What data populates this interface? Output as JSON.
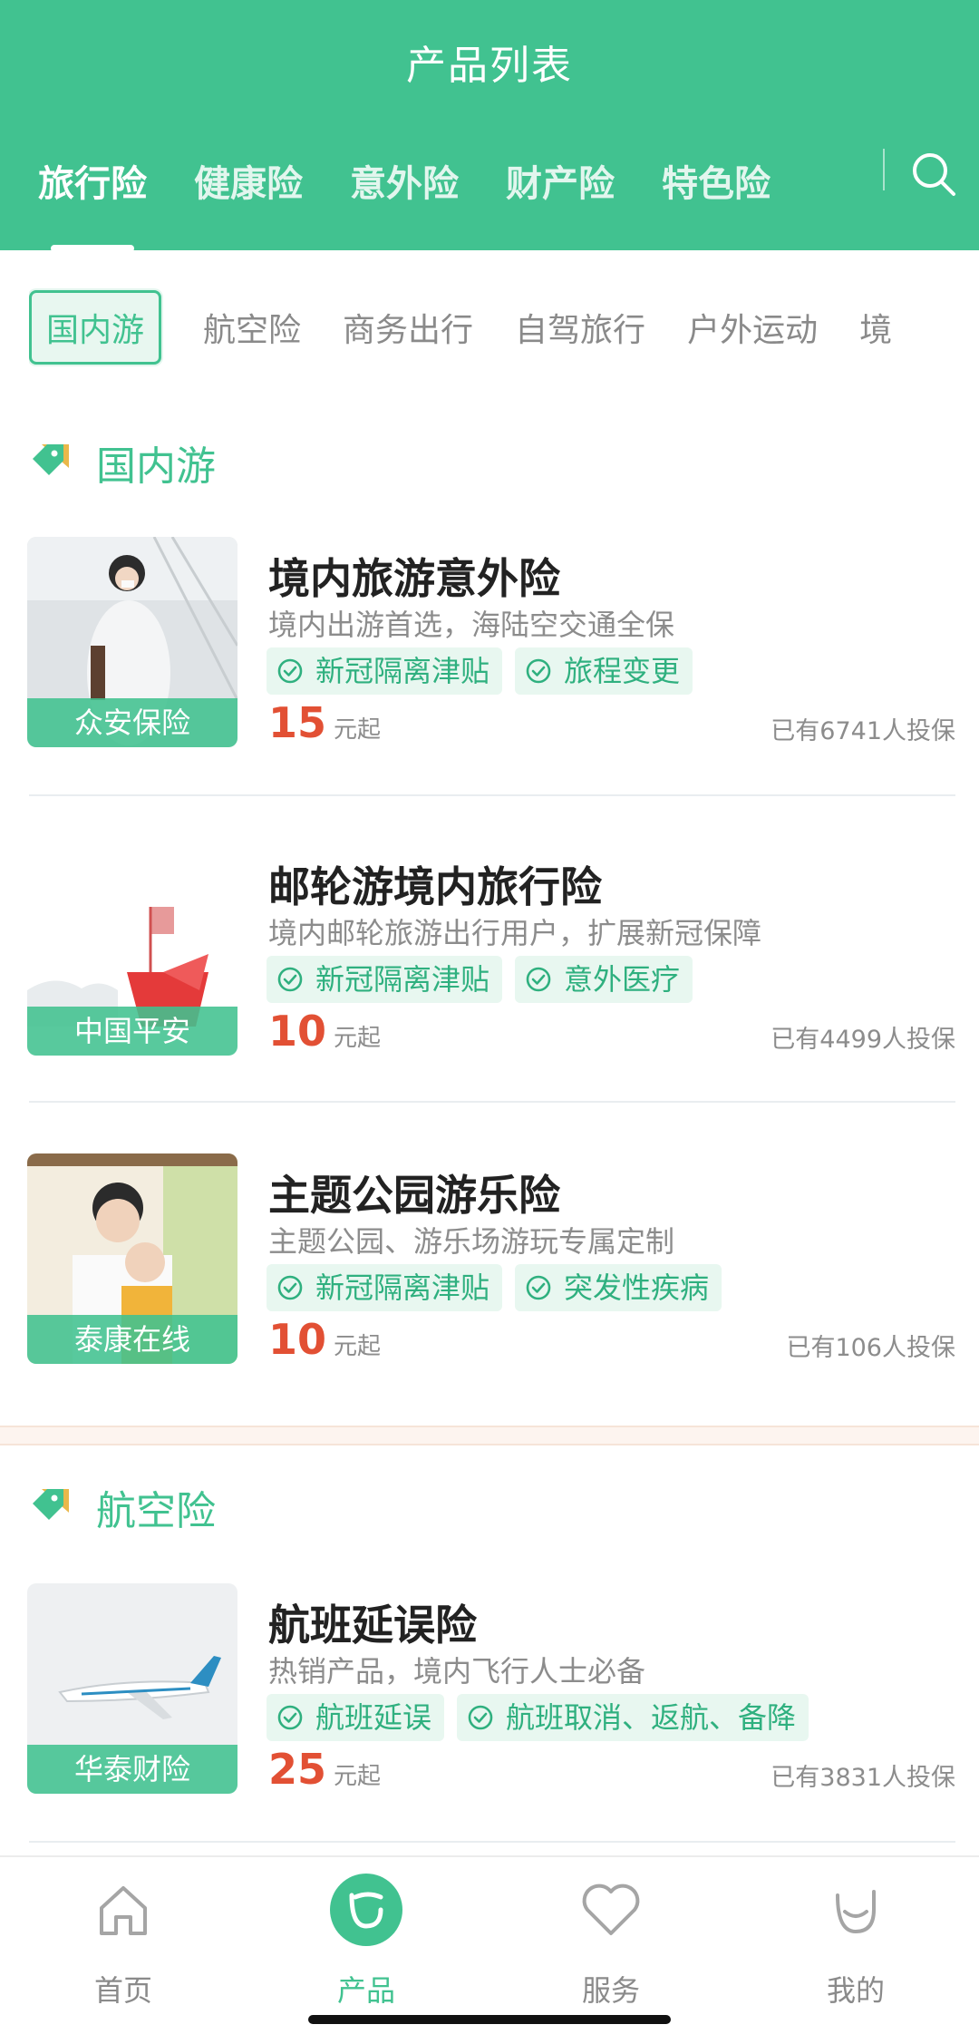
{
  "header": {
    "title": "产品列表",
    "tabs": [
      "旅行险",
      "健康险",
      "意外险",
      "财产险",
      "特色险"
    ],
    "active_tab": "旅行险",
    "search_icon": "search-icon"
  },
  "subtabs": [
    "国内游",
    "航空险",
    "商务出行",
    "自驾旅行",
    "户外运动",
    "境"
  ],
  "sections": [
    {
      "title": "国内游",
      "icon": "tag-icon",
      "products": [
        {
          "name": "境内旅游意外险",
          "desc": "境内出游首选，海陆空交通全保",
          "tags": [
            "新冠隔离津贴",
            "旅程变更"
          ],
          "price": "15",
          "price_unit": "元起",
          "count": "已有6741人投保",
          "insurer": "众安保险"
        },
        {
          "name": "邮轮游境内旅行险",
          "desc": "境内邮轮旅游出行用户，扩展新冠保障",
          "tags": [
            "新冠隔离津贴",
            "意外医疗"
          ],
          "price": "10",
          "price_unit": "元起",
          "count": "已有4499人投保",
          "insurer": "中国平安"
        },
        {
          "name": "主题公园游乐险",
          "desc": "主题公园、游乐场游玩专属定制",
          "tags": [
            "新冠隔离津贴",
            "突发性疾病"
          ],
          "price": "10",
          "price_unit": "元起",
          "count": "已有106人投保",
          "insurer": "泰康在线"
        }
      ]
    },
    {
      "title": "航空险",
      "icon": "tag-icon",
      "products": [
        {
          "name": "航班延误险",
          "desc": "热销产品，境内飞行人士必备",
          "tags": [
            "航班延误",
            "航班取消、返航、备降"
          ],
          "price": "25",
          "price_unit": "元起",
          "count": "已有3831人投保",
          "insurer": "华泰财险"
        }
      ]
    }
  ],
  "bottom_nav": [
    {
      "label": "首页",
      "icon": "home-icon"
    },
    {
      "label": "产品",
      "icon": "smile-badge-icon"
    },
    {
      "label": "服务",
      "icon": "heart-icon"
    },
    {
      "label": "我的",
      "icon": "smile-icon"
    }
  ],
  "colors": {
    "brand": "#41c290",
    "price": "#e25034",
    "tag_bg": "#e8f7f0"
  }
}
